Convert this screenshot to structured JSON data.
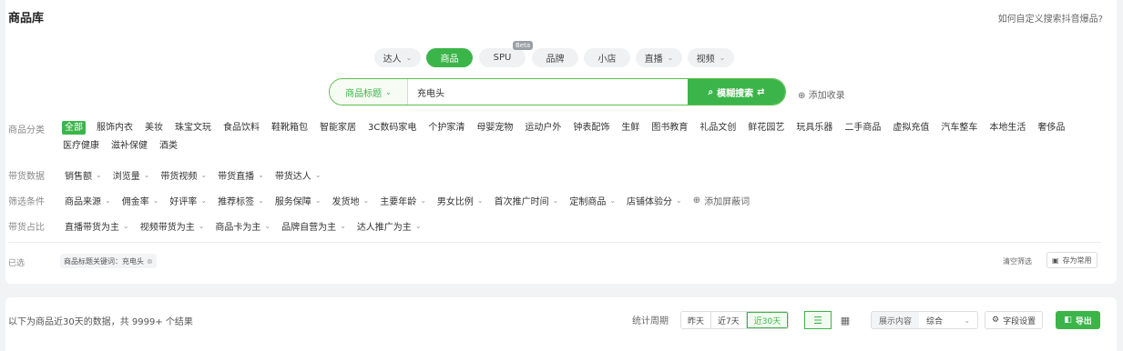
{
  "page": {
    "title": "商品库",
    "help_link": "如何自定义搜索抖音爆品?"
  },
  "source_tabs": [
    {
      "label": "达人",
      "dropdown": true
    },
    {
      "label": "商品",
      "active": true
    },
    {
      "label": "SPU",
      "badge": "Beta"
    },
    {
      "label": "品牌"
    },
    {
      "label": "小店"
    },
    {
      "label": "直播",
      "dropdown": true
    },
    {
      "label": "视频",
      "dropdown": true
    }
  ],
  "search": {
    "field_select": "商品标题",
    "value": "充电头",
    "button_label": "模糊搜索",
    "add_collection": "添加收录"
  },
  "category": {
    "label": "商品分类",
    "items": [
      "全部",
      "服饰内衣",
      "美妆",
      "珠宝文玩",
      "食品饮料",
      "鞋靴箱包",
      "智能家居",
      "3C数码家电",
      "个护家清",
      "母婴宠物",
      "运动户外",
      "钟表配饰",
      "生鲜",
      "图书教育",
      "礼品文创",
      "鲜花园艺",
      "玩具乐器",
      "二手商品",
      "虚拟充值",
      "汽车整车",
      "本地生活",
      "奢侈品",
      "医疗健康",
      "滋补保健",
      "酒类"
    ]
  },
  "sales_data": {
    "label": "带货数据",
    "items": [
      "销售额",
      "浏览量",
      "带货视频",
      "带货直播",
      "带货达人"
    ]
  },
  "filter_conditions": {
    "label": "筛选条件",
    "items": [
      "商品来源",
      "佣金率",
      "好评率",
      "推荐标签",
      "服务保障",
      "发货地",
      "主要年龄",
      "男女比例",
      "首次推广时间",
      "定制商品",
      "店铺体验分"
    ],
    "add_block_word": "添加屏蔽词"
  },
  "sales_ratio": {
    "label": "带货占比",
    "items": [
      "直播带货为主",
      "视频带货为主",
      "商品卡为主",
      "品牌自营为主",
      "达人推广为主"
    ]
  },
  "selected": {
    "label": "已选",
    "chips": [
      "商品标题关键词：充电头"
    ],
    "clear_label": "清空筛选",
    "save_label": "存为常用"
  },
  "results": {
    "summary": "以下为商品近30天的数据，共 9999+ 个结果",
    "period_label": "统计周期",
    "periods": [
      {
        "label": "昨天"
      },
      {
        "label": "近7天"
      },
      {
        "label": "近30天",
        "active": true
      }
    ],
    "display_label": "展示内容",
    "display_value": "综合",
    "field_settings": "字段设置",
    "export_label": "导出"
  },
  "colors": {
    "accent": "#3bb54a",
    "page_bg": "#f2f3f5"
  }
}
